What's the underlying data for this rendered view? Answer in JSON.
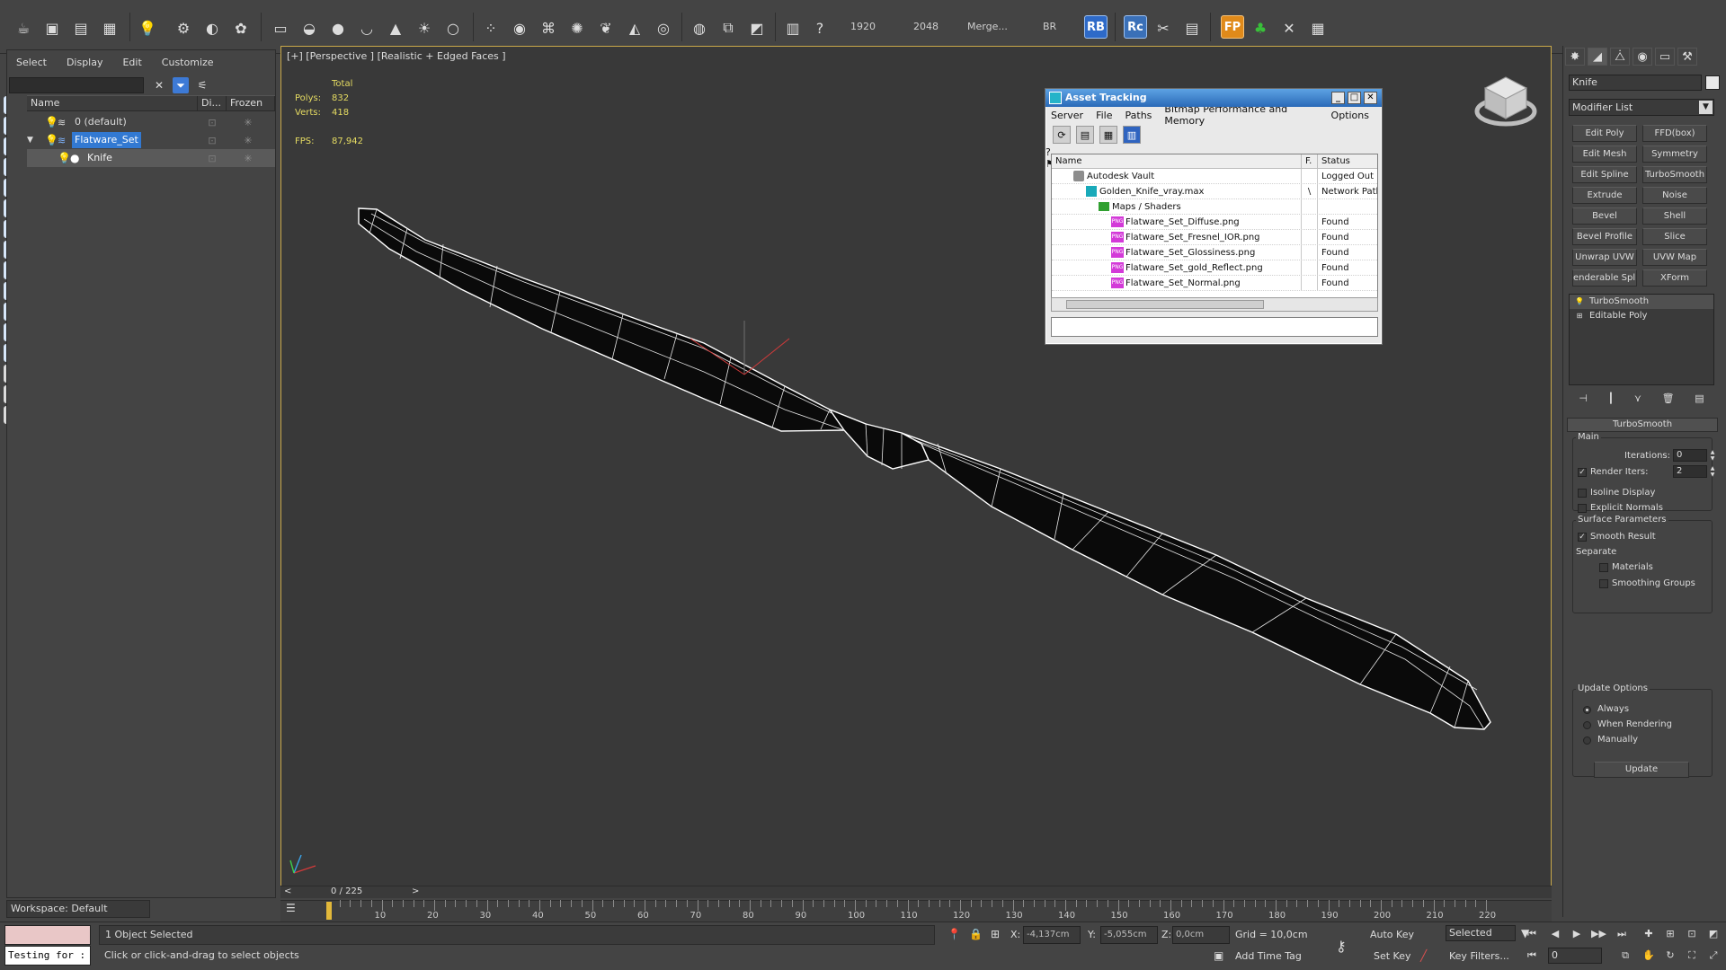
{
  "toolbar": {
    "readout_1": "1920",
    "readout_2": "2048",
    "merge_label": "Merge...",
    "br_label": "BR",
    "rb_label": "RB",
    "rc_label": "Rc",
    "fp_label": "FP"
  },
  "explorer": {
    "menu": [
      "Select",
      "Display",
      "Edit",
      "Customize"
    ],
    "columns": [
      "Name",
      "Di...",
      "Frozen"
    ],
    "rows": [
      {
        "name": "0 (default)",
        "level": 0,
        "selected": false
      },
      {
        "name": "Flatware_Set",
        "level": 0,
        "selected": true
      },
      {
        "name": "Knife",
        "level": 1,
        "selected": false
      }
    ],
    "workspace": "Workspace: Default"
  },
  "viewport": {
    "label": "[+] [Perspective ] [Realistic + Edged Faces ]",
    "stats_header": "Total",
    "polys_label": "Polys:",
    "polys_value": "832",
    "verts_label": "Verts:",
    "verts_value": "418",
    "fps_label": "FPS:",
    "fps_value": "87,942"
  },
  "asset_tracking": {
    "title": "Asset Tracking",
    "menu": [
      "Server",
      "File",
      "Paths",
      "Bitmap Performance and Memory",
      "Options"
    ],
    "columns": [
      "Name",
      "F.",
      "Status"
    ],
    "rows": [
      {
        "name": "Autodesk Vault",
        "icon": "vault-icon",
        "indent": 1,
        "f": "",
        "status": "Logged Out"
      },
      {
        "name": "Golden_Knife_vray.max",
        "icon": "max-file-icon",
        "indent": 2,
        "f": "\\",
        "status": "Network Path"
      },
      {
        "name": "Maps / Shaders",
        "icon": "folder-icon",
        "indent": 3,
        "f": "",
        "status": ""
      },
      {
        "name": "Flatware_Set_Diffuse.png",
        "icon": "png-icon",
        "indent": 4,
        "f": "",
        "status": "Found"
      },
      {
        "name": "Flatware_Set_Fresnel_IOR.png",
        "icon": "png-icon",
        "indent": 4,
        "f": "",
        "status": "Found"
      },
      {
        "name": "Flatware_Set_Glossiness.png",
        "icon": "png-icon",
        "indent": 4,
        "f": "",
        "status": "Found"
      },
      {
        "name": "Flatware_Set_gold_Reflect.png",
        "icon": "png-icon",
        "indent": 4,
        "f": "",
        "status": "Found"
      },
      {
        "name": "Flatware_Set_Normal.png",
        "icon": "png-icon",
        "indent": 4,
        "f": "",
        "status": "Found"
      }
    ]
  },
  "command_panel": {
    "object_name": "Knife",
    "modifier_list": "Modifier List",
    "modifier_buttons": [
      "Edit Poly",
      "FFD(box)",
      "Edit Mesh",
      "Symmetry",
      "Edit Spline",
      "TurboSmooth",
      "Extrude",
      "Noise",
      "Bevel",
      "Shell",
      "Bevel Profile",
      "Slice",
      "Unwrap UVW",
      "UVW Map",
      "enderable Splin",
      "XForm"
    ],
    "stack": [
      "TurboSmooth",
      "Editable Poly"
    ],
    "rollout_title": "TurboSmooth",
    "main_label": "Main",
    "iterations_label": "Iterations:",
    "iterations_value": "0",
    "render_iters_label": "Render Iters:",
    "render_iters_value": "2",
    "isoline_label": "Isoline Display",
    "explicit_normals_label": "Explicit Normals",
    "surface_params_label": "Surface Parameters",
    "smooth_result_label": "Smooth Result",
    "separate_label": "Separate",
    "materials_label": "Materials",
    "smoothing_groups_label": "Smoothing Groups",
    "update_options_label": "Update Options",
    "always_label": "Always",
    "when_rendering_label": "When Rendering",
    "manually_label": "Manually",
    "update_button": "Update"
  },
  "timeline": {
    "frame_label": "0 / 225",
    "prev": "<",
    "next": ">",
    "ticks": [
      "10",
      "20",
      "30",
      "40",
      "50",
      "60",
      "70",
      "80",
      "90",
      "100",
      "110",
      "120",
      "130",
      "140",
      "150",
      "160",
      "170",
      "180",
      "190",
      "200",
      "210",
      "220"
    ]
  },
  "status": {
    "maxscript_text": "Testing for :",
    "selection": "1 Object Selected",
    "prompt": "Click or click-and-drag to select objects",
    "x_label": "X:",
    "x_value": "-4,137cm",
    "y_label": "Y:",
    "y_value": "-5,055cm",
    "z_label": "Z:",
    "z_value": "0,0cm",
    "grid": "Grid = 10,0cm",
    "add_time_tag": "Add Time Tag",
    "auto_key": "Auto Key",
    "set_key": "Set Key",
    "selected": "Selected",
    "key_filters": "Key Filters...",
    "frame_value": "0"
  },
  "colors": {
    "selection_blue": "#3279d2",
    "viewport_border": "#c9a94a",
    "stats_yellow": "#e6dc62"
  }
}
